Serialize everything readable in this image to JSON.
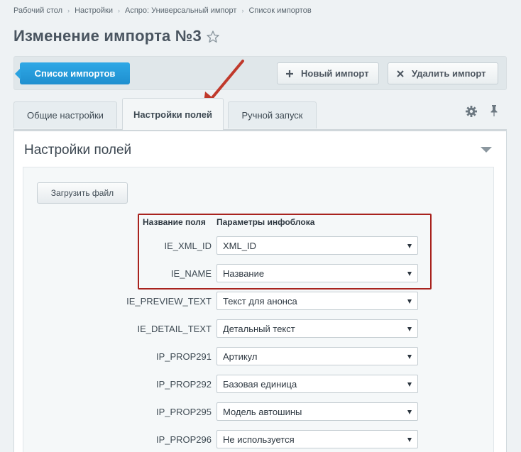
{
  "breadcrumb": [
    "Рабочий стол",
    "Настройки",
    "Аспро: Универсальный импорт",
    "Список импортов"
  ],
  "page_title": "Изменение импорта №3",
  "toolbar": {
    "list_label": "Список импортов",
    "new_label": "Новый импорт",
    "delete_label": "Удалить импорт"
  },
  "tabs": {
    "general": "Общие настройки",
    "fields": "Настройки полей",
    "manual": "Ручной запуск"
  },
  "section_title": "Настройки полей",
  "load_file_label": "Загрузить файл",
  "table": {
    "col_name": "Название поля",
    "col_params": "Параметры инфоблока",
    "rows": [
      {
        "field": "IE_XML_ID",
        "value": "XML_ID"
      },
      {
        "field": "IE_NAME",
        "value": "Название"
      },
      {
        "field": "IE_PREVIEW_TEXT",
        "value": "Текст для анонса"
      },
      {
        "field": "IE_DETAIL_TEXT",
        "value": "Детальный текст"
      },
      {
        "field": "IP_PROP291",
        "value": "Артикул"
      },
      {
        "field": "IP_PROP292",
        "value": "Базовая единица"
      },
      {
        "field": "IP_PROP295",
        "value": "Модель автошины"
      },
      {
        "field": "IP_PROP296",
        "value": "Не используется"
      }
    ]
  },
  "colors": {
    "accent": "#1e8fcf",
    "highlight": "#a8231e",
    "annotation_arrow": "#c0392b"
  }
}
